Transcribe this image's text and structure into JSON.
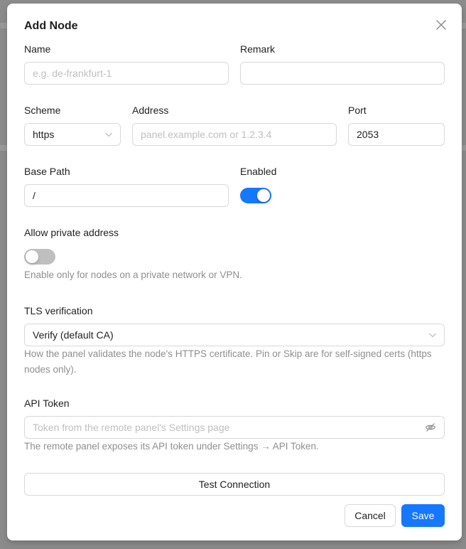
{
  "modal": {
    "title": "Add Node",
    "fields": {
      "name": {
        "label": "Name",
        "value": "",
        "placeholder": "e.g. de-frankfurt-1"
      },
      "remark": {
        "label": "Remark",
        "value": "",
        "placeholder": ""
      },
      "scheme": {
        "label": "Scheme",
        "value": "https"
      },
      "address": {
        "label": "Address",
        "value": "",
        "placeholder": "panel.example.com or 1.2.3.4"
      },
      "port": {
        "label": "Port",
        "value": "2053"
      },
      "base_path": {
        "label": "Base Path",
        "value": "/"
      },
      "enabled": {
        "label": "Enabled",
        "on": true
      },
      "allow_private": {
        "label": "Allow private address",
        "on": false,
        "help": "Enable only for nodes on a private network or VPN."
      },
      "tls": {
        "label": "TLS verification",
        "value": "Verify (default CA)",
        "help_line1": "How the panel validates the node's HTTPS certificate. Pin or Skip are for self-signed certs (https",
        "help_line2": "nodes only)."
      },
      "api_token": {
        "label": "API Token",
        "value": "",
        "placeholder": "Token from the remote panel's Settings page",
        "help": "The remote panel exposes its API token under Settings → API Token."
      }
    },
    "buttons": {
      "test": "Test Connection",
      "cancel": "Cancel",
      "save": "Save"
    }
  },
  "colors": {
    "primary": "#1677ff",
    "toggle_off": "#bfbfbf",
    "mask": "#8c8c8c"
  },
  "icons": {
    "close": "close-icon",
    "chevron": "chevron-down-icon",
    "eye": "eye-invisible-icon"
  }
}
